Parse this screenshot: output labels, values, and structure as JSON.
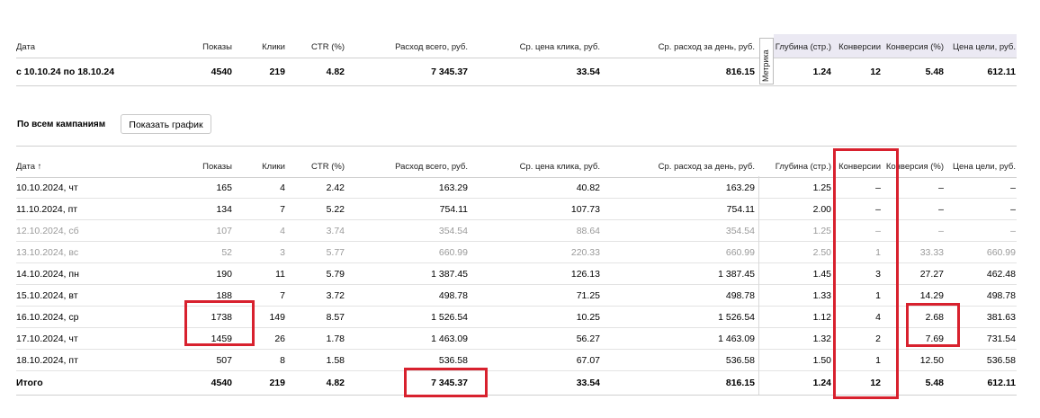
{
  "summary": {
    "headers": {
      "date": "Дата",
      "impressions": "Показы",
      "clicks": "Клики",
      "ctr": "CTR (%)",
      "spend": "Расход всего, руб.",
      "cpc": "Ср. цена клика, руб.",
      "daily": "Ср. расход за день, руб.",
      "metrika": "Метрика",
      "depth": "Глубина (стр.)",
      "conv": "Конверсии",
      "conv_rate": "Конверсия (%)",
      "goal_cost": "Цена цели, руб."
    },
    "row": {
      "date": "с 10.10.24 по 18.10.24",
      "impressions": "4540",
      "clicks": "219",
      "ctr": "4.82",
      "spend": "7 345.37",
      "cpc": "33.54",
      "daily": "816.15",
      "depth": "1.24",
      "conv": "12",
      "conv_rate": "5.48",
      "goal_cost": "612.11"
    },
    "highlight_color": "#ebe9f3"
  },
  "section": {
    "title": "По всем кампаниям",
    "chart_button": "Показать график"
  },
  "daily": {
    "headers": {
      "date": "Дата ↑",
      "impressions": "Показы",
      "clicks": "Клики",
      "ctr": "CTR (%)",
      "spend": "Расход всего, руб.",
      "cpc": "Ср. цена клика, руб.",
      "daily": "Ср. расход за день, руб.",
      "depth": "Глубина (стр.)",
      "conv": "Конверсии",
      "conv_rate": "Конверсия (%)",
      "goal_cost": "Цена цели, руб."
    },
    "rows": [
      {
        "date": "10.10.2024, чт",
        "impressions": "165",
        "clicks": "4",
        "ctr": "2.42",
        "spend": "163.29",
        "cpc": "40.82",
        "daily": "163.29",
        "depth": "1.25",
        "conv": "–",
        "conv_rate": "–",
        "goal_cost": "–"
      },
      {
        "date": "11.10.2024, пт",
        "impressions": "134",
        "clicks": "7",
        "ctr": "5.22",
        "spend": "754.11",
        "cpc": "107.73",
        "daily": "754.11",
        "depth": "2.00",
        "conv": "–",
        "conv_rate": "–",
        "goal_cost": "–"
      },
      {
        "date": "12.10.2024, сб",
        "impressions": "107",
        "clicks": "4",
        "ctr": "3.74",
        "spend": "354.54",
        "cpc": "88.64",
        "daily": "354.54",
        "depth": "1.25",
        "conv": "–",
        "conv_rate": "–",
        "goal_cost": "–"
      },
      {
        "date": "13.10.2024, вс",
        "impressions": "52",
        "clicks": "3",
        "ctr": "5.77",
        "spend": "660.99",
        "cpc": "220.33",
        "daily": "660.99",
        "depth": "2.50",
        "conv": "1",
        "conv_rate": "33.33",
        "goal_cost": "660.99"
      },
      {
        "date": "14.10.2024, пн",
        "impressions": "190",
        "clicks": "11",
        "ctr": "5.79",
        "spend": "1 387.45",
        "cpc": "126.13",
        "daily": "1 387.45",
        "depth": "1.45",
        "conv": "3",
        "conv_rate": "27.27",
        "goal_cost": "462.48"
      },
      {
        "date": "15.10.2024, вт",
        "impressions": "188",
        "clicks": "7",
        "ctr": "3.72",
        "spend": "498.78",
        "cpc": "71.25",
        "daily": "498.78",
        "depth": "1.33",
        "conv": "1",
        "conv_rate": "14.29",
        "goal_cost": "498.78"
      },
      {
        "date": "16.10.2024, ср",
        "impressions": "1738",
        "clicks": "149",
        "ctr": "8.57",
        "spend": "1 526.54",
        "cpc": "10.25",
        "daily": "1 526.54",
        "depth": "1.12",
        "conv": "4",
        "conv_rate": "2.68",
        "goal_cost": "381.63"
      },
      {
        "date": "17.10.2024, чт",
        "impressions": "1459",
        "clicks": "26",
        "ctr": "1.78",
        "spend": "1 463.09",
        "cpc": "56.27",
        "daily": "1 463.09",
        "depth": "1.32",
        "conv": "2",
        "conv_rate": "7.69",
        "goal_cost": "731.54"
      },
      {
        "date": "18.10.2024, пт",
        "impressions": "507",
        "clicks": "8",
        "ctr": "1.58",
        "spend": "536.58",
        "cpc": "67.07",
        "daily": "536.58",
        "depth": "1.50",
        "conv": "1",
        "conv_rate": "12.50",
        "goal_cost": "536.58"
      }
    ],
    "total": {
      "date": "Итого",
      "impressions": "4540",
      "clicks": "219",
      "ctr": "4.82",
      "spend": "7 345.37",
      "cpc": "33.54",
      "daily": "816.15",
      "depth": "1.24",
      "conv": "12",
      "conv_rate": "5.48",
      "goal_cost": "612.11"
    }
  },
  "colors": {
    "annotation_red": "#d8212e",
    "weekend_text": "#9a9a9a"
  }
}
